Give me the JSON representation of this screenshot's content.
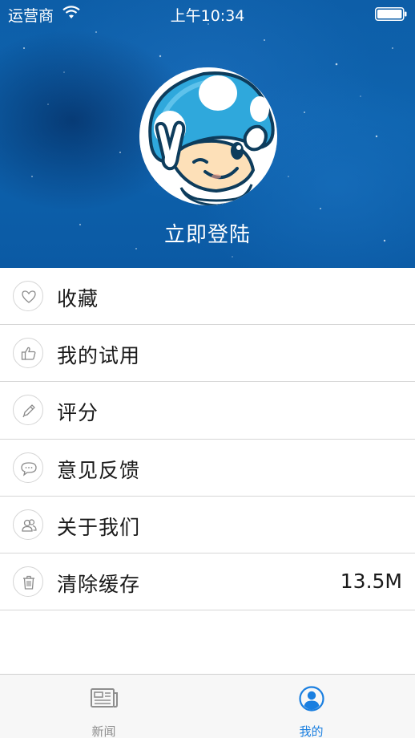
{
  "status_bar": {
    "carrier": "运营商",
    "time": "上午10:34",
    "wifi_icon": "wifi-icon",
    "battery_icon": "battery-icon"
  },
  "profile": {
    "avatar_icon": "mushroom-mascot-avatar",
    "login_label": "立即登陆"
  },
  "menu": {
    "items": [
      {
        "label": "收藏",
        "icon": "heart-icon"
      },
      {
        "label": "我的试用",
        "icon": "thumbs-up-icon"
      },
      {
        "label": "评分",
        "icon": "pencil-icon"
      },
      {
        "label": "意见反馈",
        "icon": "chat-bubble-icon"
      },
      {
        "label": "关于我们",
        "icon": "users-icon"
      },
      {
        "label": "清除缓存",
        "icon": "trash-icon",
        "value": "13.5M"
      }
    ]
  },
  "tab_bar": {
    "tabs": [
      {
        "label": "新闻",
        "icon": "newspaper-icon",
        "active": false
      },
      {
        "label": "我的",
        "icon": "person-icon",
        "active": true
      }
    ]
  },
  "colors": {
    "header_blue": "#0e63ae",
    "active_tab": "#1a7fe0",
    "inactive_tab": "#8e8e8e",
    "divider": "#d6d6d6"
  }
}
